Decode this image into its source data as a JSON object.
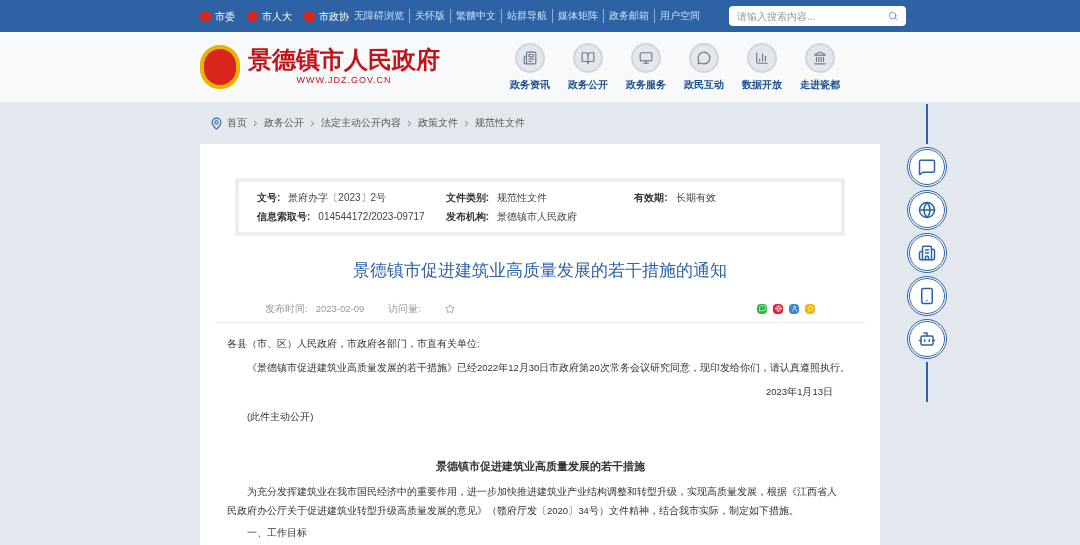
{
  "top_bar": {
    "org_links": [
      "市委",
      "市人大",
      "市政协"
    ],
    "links": [
      "无障碍浏览",
      "关怀版",
      "繁體中文",
      "站群导航",
      "媒体矩阵",
      "政务邮箱",
      "用户空间"
    ],
    "search": {
      "placeholder": "请输入搜索内容..."
    }
  },
  "header": {
    "site_name": "景德镇市人民政府",
    "site_url": "WWW.JDZ.GOV.CN",
    "nav": [
      {
        "label": "政务资讯",
        "kind": "news"
      },
      {
        "label": "政务公开",
        "kind": "open"
      },
      {
        "label": "政务服务",
        "kind": "service"
      },
      {
        "label": "政民互动",
        "kind": "interact"
      },
      {
        "label": "数据开放",
        "kind": "data"
      },
      {
        "label": "走进瓷都",
        "kind": "city"
      }
    ]
  },
  "breadcrumb": [
    "首页",
    "政务公开",
    "法定主动公开内容",
    "政策文件",
    "规范性文件"
  ],
  "meta": [
    {
      "label": "文号:",
      "value": "景府办字〔2023〕2号"
    },
    {
      "label": "文件类别:",
      "value": "规范性文件"
    },
    {
      "label": "有效期:",
      "value": "长期有效"
    },
    {
      "label": "信息索取号:",
      "value": "014544172/2023-09717"
    },
    {
      "label": "发布机构:",
      "value": "景德镇市人民政府"
    }
  ],
  "article": {
    "title": "景德镇市促进建筑业高质量发展的若干措施的通知",
    "publish_label": "发布时间:",
    "publish_date": "2023-02-09",
    "views_label": "访问量:",
    "salutation": "各县（市、区）人民政府，市政府各部门，市直有关单位:",
    "body": "《景德镇市促进建筑业高质量发展的若干措施》已经2022年12月30日市政府第20次常务会议研究同意，现印发给你们，请认真遵照执行。",
    "date": "2023年1月13日",
    "note": "(此件主动公开)",
    "subtitle": "景德镇市促进建筑业高质量发展的若干措施",
    "intro": "为充分发挥建筑业在我市国民经济中的重要作用，进一步加快推进建筑业产业结构调整和转型升级，实现高质量发展，根据《江西省人民政府办公厅关于促进建筑业转型升级高质量发展的意见》（赣府厅发〔2020〕34号）文件精神，结合我市实际，制定如下措施。",
    "section": "一、工作目标"
  }
}
